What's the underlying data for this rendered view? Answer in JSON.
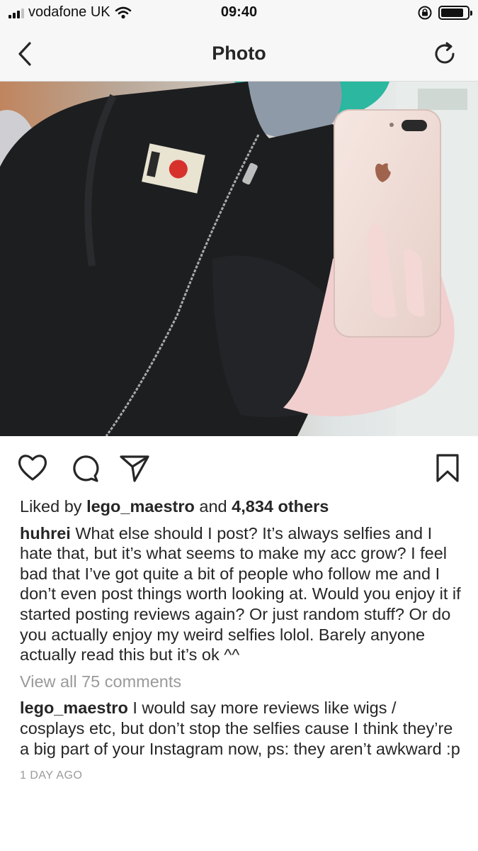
{
  "status_bar": {
    "carrier": "vodafone UK",
    "time": "09:40",
    "battery_level": 0.85
  },
  "nav": {
    "title": "Photo",
    "back_icon": "chevron-left-icon",
    "refresh_icon": "refresh-icon"
  },
  "photo": {
    "description_icon": "selfie-photo"
  },
  "actions": {
    "like_icon": "heart-icon",
    "comment_icon": "comment-icon",
    "share_icon": "direct-share-icon",
    "save_icon": "bookmark-icon"
  },
  "likes": {
    "prefix": "Liked by ",
    "user": "lego_maestro",
    "middle": " and ",
    "others": "4,834 others"
  },
  "caption": {
    "username": "huhrei",
    "text": " What else should I post? It’s always selfies and I hate that, but it’s what seems to make my acc grow? I feel bad that I’ve got quite a bit of people who follow me and I don’t even post things worth looking at. Would you enjoy it if started posting reviews again? Or just random stuff? Or do you actually enjoy my weird selfies lolol. Barely anyone actually read this but it’s ok ^^"
  },
  "view_all_comments": "View all 75 comments",
  "comments": [
    {
      "username": "lego_maestro",
      "text": " I would say more reviews like wigs / cosplays etc, but don’t stop the selfies cause I think they’re a big part of your Instagram now, ps: they aren’t awkward :p"
    }
  ],
  "timestamp": "1 DAY AGO"
}
